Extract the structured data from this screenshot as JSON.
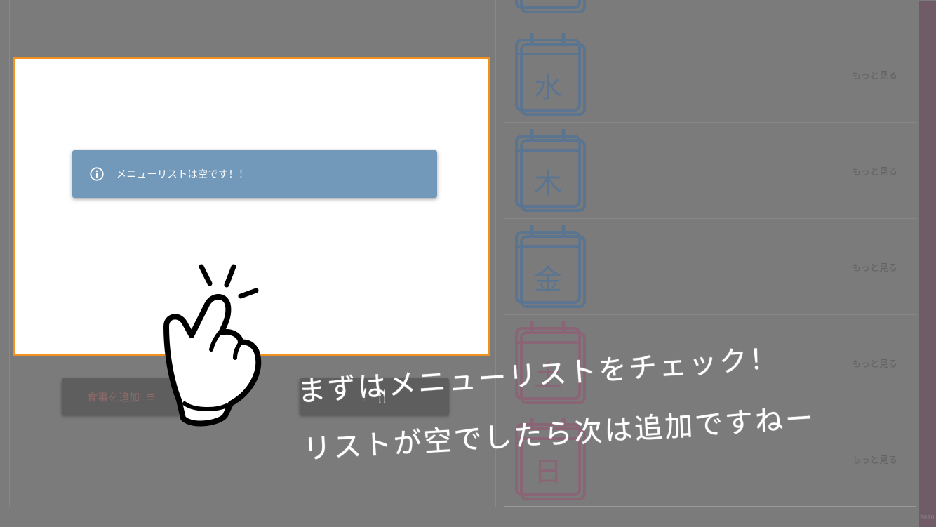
{
  "alert": {
    "icon": "info-icon",
    "message": "メニューリストは空です！！"
  },
  "buttons": {
    "add_meal": {
      "label": "食事を追加",
      "icon": "list-icon",
      "glyph": "≡"
    },
    "menu_list": {
      "label": "ッ",
      "icon": "utensils-icon",
      "glyph": "🍴"
    }
  },
  "days": [
    {
      "kanji": "",
      "more": "",
      "color": "#5b7590"
    },
    {
      "kanji": "水",
      "more": "もっと見る",
      "color": "#5b7590"
    },
    {
      "kanji": "木",
      "more": "もっと見る",
      "color": "#5b7590"
    },
    {
      "kanji": "金",
      "more": "もっと見る",
      "color": "#5b7590"
    },
    {
      "kanji": "土",
      "more": "もっと見る",
      "color": "#8a6575"
    },
    {
      "kanji": "日",
      "more": "もっと見る",
      "color": "#8a6575"
    }
  ],
  "tutorial": {
    "line1": "まずはメニューリストをチェック！",
    "line2": "リストが空でしたら次は追加ですねー"
  },
  "version": "2020"
}
